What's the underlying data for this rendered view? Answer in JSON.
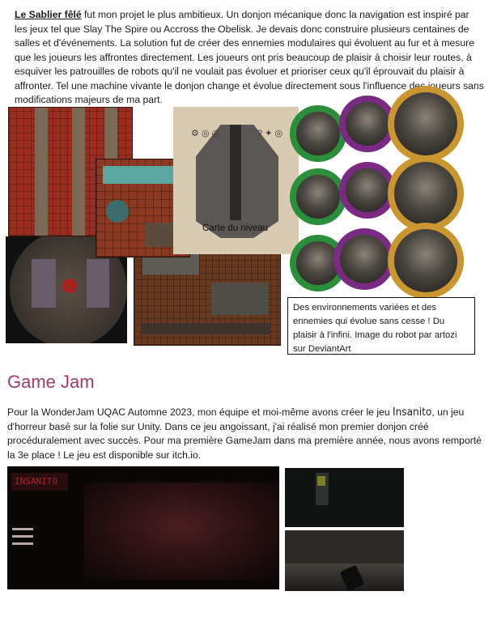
{
  "project": {
    "lead": "Le Sablier fêlé",
    "body": " fut mon projet le plus ambitieux. Un donjon mécanique  donc la navigation est inspiré par les jeux tel que Slay The Spire ou Accross the Obelisk. Je devais donc construire plusieurs centaines de salles et d'événements.  La solution fut de créer des ennemies modulaires qui évoluent au fur et à mesure que les joueurs les affrontes directement.  Les  joueurs ont pris beaucoup de plaisir à choisir leur routes, à esquiver les patrouilles de robots qu'il ne voulait pas évoluer et prioriser ceux qu'il éprouvait du plaisir à affronter. Tel une machine  vivante le donjon change et évolue directement  sous l'influence des joueurs sans modifications majeurs  de ma part."
  },
  "map_caption": "Carte du niveau",
  "image_caption": "Des environnements variées et des ennemies  qui évolue sans cesse  ! Du plaisir à l'infini. Image du robot par artozi sur DeviantArt",
  "gamejam": {
    "heading": "Game Jam",
    "text_before": "Pour la WonderJam UQAC Automne 2023, mon équipe et moi-même avons créer le jeu ",
    "game_name": "Insanito",
    "text_after": ", un jeu d'horreur basé sur la folie sur Unity. Dans ce jeu angoissant, j'ai réalisé mon premier donjon créé procéduralement avec succès. Pour ma première GameJam dans ma première année, nous avons remporté la 3e place ! Le jeu est disponible sur itch.io.",
    "logo_text": "INSANITO"
  },
  "token_colors": [
    "#2a8e3a",
    "#7a2a82",
    "#c9962f"
  ],
  "heading_color": "#a33a6c"
}
